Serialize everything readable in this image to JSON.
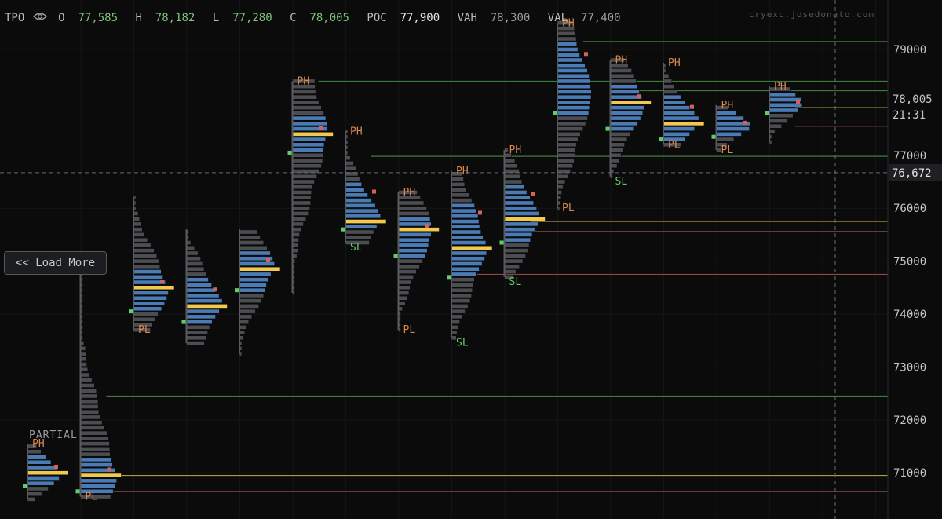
{
  "header": {
    "symbol": "TPO",
    "eye_icon": "eye-icon",
    "open_label": "O",
    "open_value": "77,585",
    "high_label": "H",
    "high_value": "78,182",
    "low_label": "L",
    "low_value": "77,280",
    "close_label": "C",
    "close_value": "78,005",
    "poc_label": "POC",
    "poc_value": "77,900",
    "vah_label": "VAH",
    "vah_value": "78,300",
    "val_label": "VAL",
    "val_value": "77,400"
  },
  "watermark": "cryexc.josedonato.com",
  "load_more_label": "<< Load More",
  "partial_label": "PARTIAL",
  "colors": {
    "background": "#0b0b0c",
    "profile": "#4a7bb4",
    "profile_outside": "#4c4d51",
    "poc": "#f2c94c",
    "high_label": "#d9884e",
    "low_label": "#d9884e",
    "swing_low": "#5fd068",
    "green_line": "#3d7a3d",
    "red_line": "#8a4a44",
    "yellow_line": "#b59a3a",
    "up_value": "#7cc47a"
  },
  "chart_data": {
    "type": "tpo",
    "y_axis": {
      "min": 70450,
      "max": 79650,
      "ticks": [
        71000,
        72000,
        73000,
        74000,
        75000,
        76000,
        77000,
        79000
      ],
      "tick_labels": [
        "71000",
        "72000",
        "73000",
        "74000",
        "75000",
        "76000",
        "77000",
        "79000"
      ]
    },
    "last_price_label": "78,005",
    "countdown_label": "21:31",
    "crosshair_label": "76,672",
    "crosshair_price": 76672,
    "current_price": 78005,
    "profiles": [
      {
        "low": 70500,
        "high": 71550,
        "poc": 71000,
        "vah": 71300,
        "val": 70750,
        "tags": [
          "PH"
        ],
        "partial": true
      },
      {
        "low": 70550,
        "high": 74800,
        "poc": 70950,
        "vah": 71250,
        "val": 70650,
        "tags": [
          "PL"
        ]
      },
      {
        "low": 73700,
        "high": 76200,
        "poc": 74480,
        "vah": 74800,
        "val": 74050,
        "tags": [
          "PL"
        ]
      },
      {
        "low": 73450,
        "high": 75600,
        "poc": 74180,
        "vah": 74650,
        "val": 73850,
        "tags": []
      },
      {
        "low": 73250,
        "high": 75600,
        "poc": 74880,
        "vah": 75200,
        "val": 74450,
        "tags": []
      },
      {
        "low": 74400,
        "high": 78400,
        "poc": 77400,
        "vah": 77700,
        "val": 77050,
        "tags": [
          "PH"
        ]
      },
      {
        "low": 75350,
        "high": 77450,
        "poc": 75780,
        "vah": 76500,
        "val": 75600,
        "tags": [
          "PH",
          "SL"
        ]
      },
      {
        "low": 73700,
        "high": 76300,
        "poc": 75580,
        "vah": 75850,
        "val": 75100,
        "tags": [
          "PH",
          "PL"
        ]
      },
      {
        "low": 73550,
        "high": 76700,
        "poc": 75280,
        "vah": 76100,
        "val": 74700,
        "tags": [
          "PH",
          "SL"
        ]
      },
      {
        "low": 74700,
        "high": 77100,
        "poc": 75780,
        "vah": 76450,
        "val": 75350,
        "tags": [
          "PH",
          "SL"
        ]
      },
      {
        "low": 76000,
        "high": 79500,
        "poc": 78150,
        "vah": 79100,
        "val": 77800,
        "tags": [
          "PH",
          "PL"
        ]
      },
      {
        "low": 76600,
        "high": 78800,
        "poc": 77980,
        "vah": 78300,
        "val": 77500,
        "tags": [
          "PH",
          "SL"
        ]
      },
      {
        "low": 77200,
        "high": 78750,
        "poc": 77640,
        "vah": 78100,
        "val": 77300,
        "tags": [
          "PH",
          "PL"
        ]
      },
      {
        "low": 77100,
        "high": 77950,
        "poc": 77550,
        "vah": 77800,
        "val": 77350,
        "tags": [
          "PH",
          "PL"
        ]
      },
      {
        "low": 77250,
        "high": 78300,
        "poc": 78000,
        "vah": 78200,
        "val": 77800,
        "tags": [
          "PH"
        ]
      }
    ],
    "levels": [
      {
        "price": 79150,
        "color": "green",
        "from": 10
      },
      {
        "price": 78400,
        "color": "green",
        "from": 5
      },
      {
        "price": 78220,
        "color": "green",
        "from": 11
      },
      {
        "price": 77900,
        "color": "yellow",
        "from": 14
      },
      {
        "price": 77550,
        "color": "red",
        "from": 14
      },
      {
        "price": 76980,
        "color": "green",
        "from": 6
      },
      {
        "price": 75750,
        "color": "yellow",
        "from": 9
      },
      {
        "price": 75560,
        "color": "red",
        "from": 9
      },
      {
        "price": 74750,
        "color": "red",
        "from": 8
      },
      {
        "price": 72450,
        "color": "green",
        "from": 1
      },
      {
        "price": 70950,
        "color": "yellow",
        "from": 1
      },
      {
        "price": 70650,
        "color": "red",
        "from": 1
      }
    ]
  }
}
